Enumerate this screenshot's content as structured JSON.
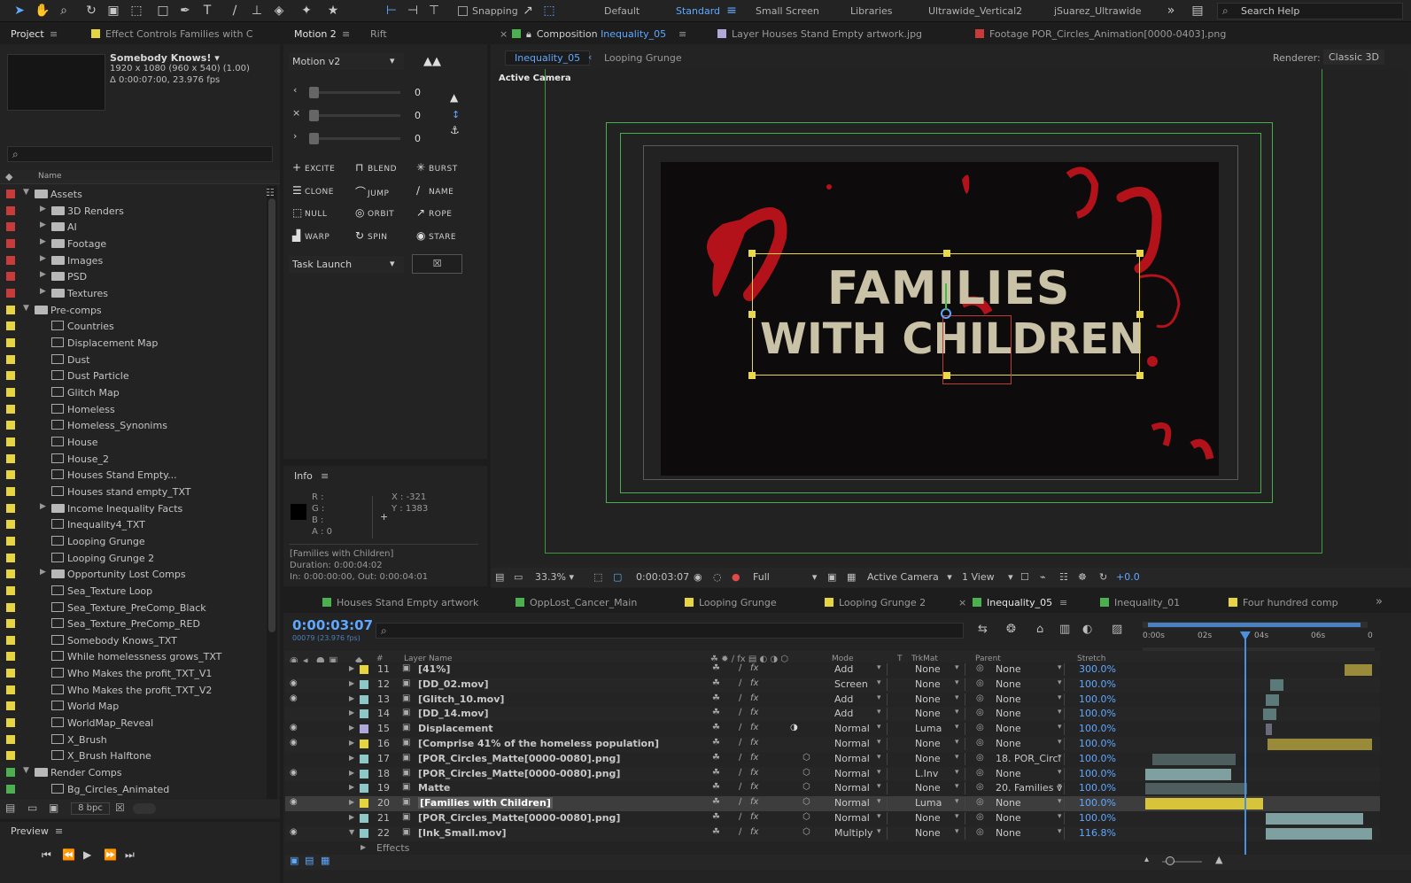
{
  "toolbar": {
    "snapping_label": "Snapping",
    "workspaces": [
      "Default",
      "Standard",
      "Small Screen",
      "Libraries",
      "Ultrawide_Vertical2",
      "jSuarez_Ultrawide"
    ],
    "active_workspace": "Standard",
    "search_placeholder": "Search Help"
  },
  "project": {
    "tab_label": "Project",
    "effect_controls_tab": "Effect Controls Families with C",
    "selected_name": "Somebody Knows!",
    "selected_info_1": "1920 x 1080  (960 x 540) (1.00)",
    "selected_info_2": "Δ 0:00:07:00, 23.976 fps",
    "column_name": "Name",
    "bpc": "8 bpc",
    "items": [
      {
        "name": "Assets",
        "type": "folder",
        "level": 0,
        "open": true,
        "color": "#c83b3b"
      },
      {
        "name": "3D Renders",
        "type": "folder",
        "level": 1,
        "open": false,
        "color": "#c83b3b"
      },
      {
        "name": "AI",
        "type": "folder",
        "level": 1,
        "open": false,
        "color": "#c83b3b"
      },
      {
        "name": "Footage",
        "type": "folder",
        "level": 1,
        "open": false,
        "color": "#c83b3b"
      },
      {
        "name": "Images",
        "type": "folder",
        "level": 1,
        "open": false,
        "color": "#c83b3b"
      },
      {
        "name": "PSD",
        "type": "folder",
        "level": 1,
        "open": false,
        "color": "#c83b3b"
      },
      {
        "name": "Textures",
        "type": "folder",
        "level": 1,
        "open": false,
        "color": "#c83b3b"
      },
      {
        "name": "Pre-comps",
        "type": "folder",
        "level": 0,
        "open": true,
        "color": "#e6d442"
      },
      {
        "name": "Countries",
        "type": "comp",
        "level": 1,
        "color": "#e6d442"
      },
      {
        "name": "Displacement Map",
        "type": "comp",
        "level": 1,
        "color": "#e6d442"
      },
      {
        "name": "Dust",
        "type": "comp",
        "level": 1,
        "color": "#e6d442"
      },
      {
        "name": "Dust Particle",
        "type": "comp",
        "level": 1,
        "color": "#e6d442"
      },
      {
        "name": "Glitch Map",
        "type": "comp",
        "level": 1,
        "color": "#e6d442"
      },
      {
        "name": "Homeless",
        "type": "comp",
        "level": 1,
        "color": "#e6d442"
      },
      {
        "name": "Homeless_Synonims",
        "type": "comp",
        "level": 1,
        "color": "#e6d442"
      },
      {
        "name": "House",
        "type": "comp",
        "level": 1,
        "color": "#e6d442"
      },
      {
        "name": "House_2",
        "type": "comp",
        "level": 1,
        "color": "#e6d442"
      },
      {
        "name": "Houses Stand Empty...",
        "type": "comp",
        "level": 1,
        "color": "#e6d442"
      },
      {
        "name": "Houses stand empty_TXT",
        "type": "comp",
        "level": 1,
        "color": "#e6d442"
      },
      {
        "name": "Income Inequality Facts",
        "type": "folder",
        "level": 1,
        "open": false,
        "color": "#e6d442"
      },
      {
        "name": "Inequality4_TXT",
        "type": "comp",
        "level": 1,
        "color": "#e6d442"
      },
      {
        "name": "Looping Grunge",
        "type": "comp",
        "level": 1,
        "color": "#e6d442"
      },
      {
        "name": "Looping Grunge 2",
        "type": "comp",
        "level": 1,
        "color": "#e6d442"
      },
      {
        "name": "Opportunity Lost Comps",
        "type": "folder",
        "level": 1,
        "open": false,
        "color": "#e6d442"
      },
      {
        "name": "Sea_Texture Loop",
        "type": "comp",
        "level": 1,
        "color": "#e6d442"
      },
      {
        "name": "Sea_Texture_PreComp_Black",
        "type": "comp",
        "level": 1,
        "color": "#e6d442"
      },
      {
        "name": "Sea_Texture_PreComp_RED",
        "type": "comp",
        "level": 1,
        "color": "#e6d442"
      },
      {
        "name": "Somebody Knows_TXT",
        "type": "comp",
        "level": 1,
        "color": "#e6d442"
      },
      {
        "name": "While homelessness grows_TXT",
        "type": "comp",
        "level": 1,
        "color": "#e6d442"
      },
      {
        "name": "Who Makes the profit_TXT_V1",
        "type": "comp",
        "level": 1,
        "color": "#e6d442"
      },
      {
        "name": "Who Makes the profit_TXT_V2",
        "type": "comp",
        "level": 1,
        "color": "#e6d442"
      },
      {
        "name": "World Map",
        "type": "comp",
        "level": 1,
        "color": "#e6d442"
      },
      {
        "name": "WorldMap_Reveal",
        "type": "comp",
        "level": 1,
        "color": "#e6d442"
      },
      {
        "name": "X_Brush",
        "type": "comp",
        "level": 1,
        "color": "#e6d442"
      },
      {
        "name": "X_Brush Halftone",
        "type": "comp",
        "level": 1,
        "color": "#e6d442"
      },
      {
        "name": "Render Comps",
        "type": "folder",
        "level": 0,
        "open": true,
        "color": "#4caf50"
      },
      {
        "name": "Bg_Circles_Animated",
        "type": "comp",
        "level": 1,
        "color": "#4caf50"
      }
    ]
  },
  "motion": {
    "tab_label": "Motion 2",
    "tab_rift": "Rift",
    "preset": "Motion v2",
    "slider_values": [
      "0",
      "0",
      "0"
    ],
    "buttons": [
      "EXCITE",
      "BLEND",
      "BURST",
      "CLONE",
      "JUMP",
      "NAME",
      "NULL",
      "ORBIT",
      "ROPE",
      "WARP",
      "SPIN",
      "STARE"
    ],
    "task_launch": "Task Launch"
  },
  "info": {
    "tab_label": "Info",
    "r": "R :",
    "g": "G :",
    "b": "B :",
    "a": "A :  0",
    "x": "X : -321",
    "y": "Y : 1383",
    "layer_name": "[Families with Children]",
    "duration": "Duration: 0:00:04:02",
    "in_out": "In: 0:00:00:00, Out: 0:00:04:01"
  },
  "preview": {
    "tab_label": "Preview"
  },
  "viewer": {
    "tabs": [
      {
        "label": "Composition",
        "highlight": "Inequality_05",
        "color": "#4caf50"
      },
      {
        "label": "Layer Houses Stand Empty artwork.jpg",
        "highlight": "",
        "color": "#b0a8d8"
      },
      {
        "label": "Footage POR_Circles_Animation[0000-0403].png",
        "highlight": "",
        "color": "#c83b3b"
      }
    ],
    "breadcrumb_active": "Inequality_05",
    "breadcrumb_2": "Looping Grunge",
    "renderer_label": "Renderer:",
    "renderer_value": "Classic 3D",
    "camera_label": "Active Camera",
    "frame_text_line1": "FAMILIES",
    "frame_text_line2": "WITH CHILDREN",
    "zoom": "33.3%",
    "timecode": "0:00:03:07",
    "resolution": "Full",
    "camera_select": "Active Camera",
    "views": "1 View",
    "exposure": "+0.0"
  },
  "timeline": {
    "tabs": [
      {
        "label": "Houses Stand Empty artwork",
        "color": "#4caf50"
      },
      {
        "label": "OppLost_Cancer_Main",
        "color": "#4caf50"
      },
      {
        "label": "Looping Grunge",
        "color": "#e6d442"
      },
      {
        "label": "Looping Grunge 2",
        "color": "#e6d442"
      },
      {
        "label": "Inequality_05",
        "color": "#4caf50"
      },
      {
        "label": "Inequality_01",
        "color": "#4caf50"
      },
      {
        "label": "Four hundred comp",
        "color": "#e6d442"
      }
    ],
    "current_time": "0:00:03:07",
    "frame_info": "00079 (23.976 fps)",
    "headers": {
      "num": "#",
      "layer_name": "Layer Name",
      "mode": "Mode",
      "t": "T",
      "trkmat": "TrkMat",
      "parent": "Parent",
      "stretch": "Stretch"
    },
    "ruler": [
      "0:00s",
      "02s",
      "04s",
      "06s",
      "0"
    ],
    "playhead_fraction": 0.437,
    "layers": [
      {
        "num": "11",
        "name": "[41%]",
        "mode": "Add",
        "trkmat": "None",
        "parent": "None",
        "stretch": "300.0%",
        "color": "#e6d442",
        "visible": false,
        "selected": false,
        "bar_start": 0.88,
        "bar_end": 1.0,
        "bar_color": "#9a8b3a"
      },
      {
        "num": "12",
        "name": "[DD_02.mov]",
        "mode": "Screen",
        "trkmat": "None",
        "parent": "None",
        "stretch": "100.0%",
        "color": "#8fc6c6",
        "visible": true,
        "selected": false,
        "bar_start": 0.55,
        "bar_end": 0.61,
        "bar_color": "#5c7a7a"
      },
      {
        "num": "13",
        "name": "[Glitch_10.mov]",
        "mode": "Add",
        "trkmat": "None",
        "parent": "None",
        "stretch": "100.0%",
        "color": "#8fc6c6",
        "visible": true,
        "selected": false,
        "bar_start": 0.53,
        "bar_end": 0.59,
        "bar_color": "#5c7a7a"
      },
      {
        "num": "14",
        "name": "[DD_14.mov]",
        "mode": "Add",
        "trkmat": "None",
        "parent": "None",
        "stretch": "100.0%",
        "color": "#8fc6c6",
        "visible": false,
        "selected": false,
        "bar_start": 0.52,
        "bar_end": 0.58,
        "bar_color": "#5c7a7a"
      },
      {
        "num": "15",
        "name": "Displacement",
        "mode": "Normal",
        "trkmat": "Luma",
        "parent": "None",
        "stretch": "100.0%",
        "color": "#b0a8d8",
        "visible": true,
        "selected": false,
        "bar_start": 0.53,
        "bar_end": 0.56,
        "bar_color": "#6a6a7a"
      },
      {
        "num": "16",
        "name": "[Comprise 41% of the homeless population]",
        "mode": "Normal",
        "trkmat": "None",
        "parent": "None",
        "stretch": "100.0%",
        "color": "#e6d442",
        "visible": true,
        "selected": false,
        "bar_start": 0.54,
        "bar_end": 1.0,
        "bar_color": "#9a8b3a"
      },
      {
        "num": "17",
        "name": "[POR_Circles_Matte[0000-0080].png]",
        "mode": "Normal",
        "trkmat": "None",
        "parent": "18. POR_Circl",
        "stretch": "100.0%",
        "color": "#8fc6c6",
        "visible": false,
        "selected": false,
        "bar_start": 0.03,
        "bar_end": 0.4,
        "bar_color": "#4e5e5e"
      },
      {
        "num": "18",
        "name": "[POR_Circles_Matte[0000-0080].png]",
        "mode": "Normal",
        "trkmat": "L.Inv",
        "parent": "None",
        "stretch": "100.0%",
        "color": "#8fc6c6",
        "visible": true,
        "selected": false,
        "bar_start": 0.0,
        "bar_end": 0.38,
        "bar_color": "#7fa0a0"
      },
      {
        "num": "19",
        "name": "Matte",
        "mode": "Normal",
        "trkmat": "None",
        "parent": "20. Families v",
        "stretch": "100.0%",
        "color": "#8fc6c6",
        "visible": false,
        "selected": false,
        "bar_start": 0.0,
        "bar_end": 0.45,
        "bar_color": "#4e5e5e"
      },
      {
        "num": "20",
        "name": "[Families with Children]",
        "mode": "Normal",
        "trkmat": "Luma",
        "parent": "None",
        "stretch": "100.0%",
        "color": "#e6d442",
        "visible": true,
        "selected": true,
        "bar_start": 0.0,
        "bar_end": 0.52,
        "bar_color": "#d8c43a"
      },
      {
        "num": "21",
        "name": "[POR_Circles_Matte[0000-0080].png]",
        "mode": "Normal",
        "trkmat": "None",
        "parent": "None",
        "stretch": "100.0%",
        "color": "#8fc6c6",
        "visible": false,
        "selected": false,
        "bar_start": 0.53,
        "bar_end": 0.96,
        "bar_color": "#7fa0a0"
      },
      {
        "num": "22",
        "name": "[Ink_Small.mov]",
        "mode": "Multiply",
        "trkmat": "None",
        "parent": "None",
        "stretch": "116.8%",
        "color": "#8fc6c6",
        "visible": true,
        "selected": false,
        "bar_start": 0.53,
        "bar_end": 1.0,
        "bar_color": "#7fa0a0"
      }
    ],
    "effects_label": "Effects"
  }
}
